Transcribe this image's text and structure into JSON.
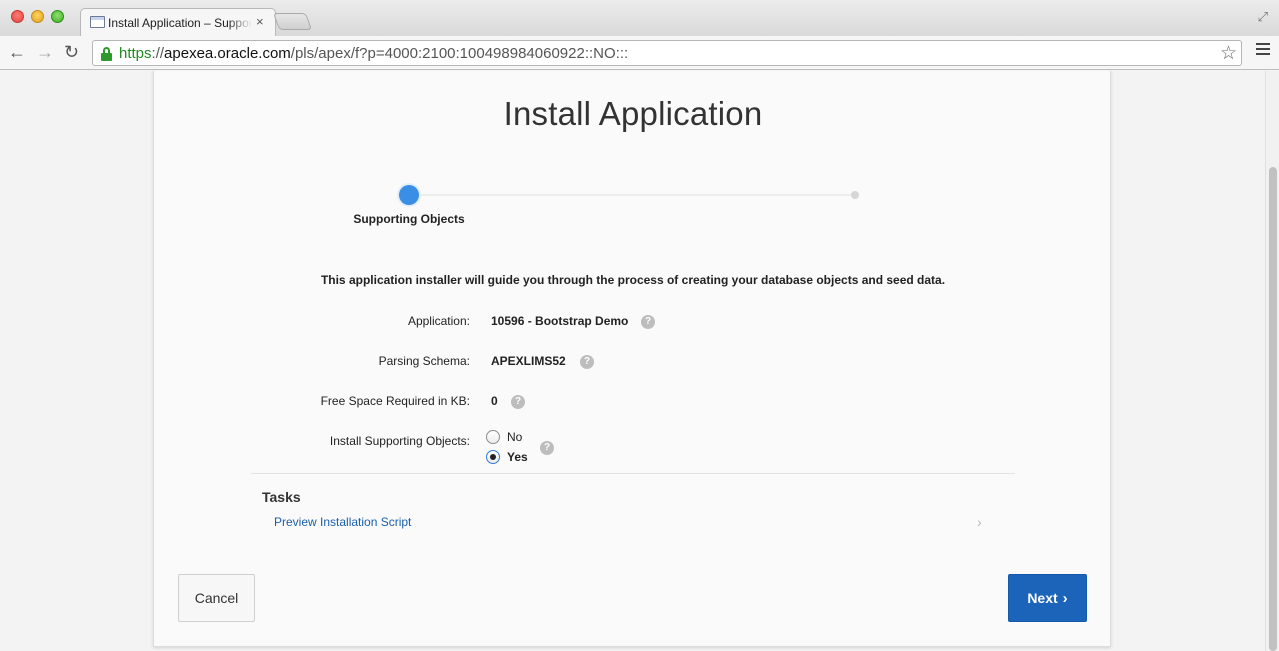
{
  "browser": {
    "tab_title": "Install Application – Supporting Objects",
    "tab_close": "×",
    "url_scheme": "https",
    "url_sep": "://",
    "url_host": "apexea.oracle.com",
    "url_path": "/pls/apex/f?p=4000:2100:100498984060922::NO:::",
    "back_glyph": "←",
    "forward_glyph": "→",
    "reload_glyph": "↻",
    "star_glyph": "☆",
    "resize_glyph": "⤢"
  },
  "page": {
    "title": "Install Application",
    "wizard": {
      "current_step_label": "Supporting Objects",
      "step_color": "#3b8ee6"
    },
    "intro": "This application installer will guide you through the process of creating your database objects and seed data.",
    "fields": {
      "application": {
        "label": "Application:",
        "value": "10596 - Bootstrap Demo"
      },
      "parsing_schema": {
        "label": "Parsing Schema:",
        "value": "APEXLIMS52"
      },
      "free_space": {
        "label": "Free Space Required in KB:",
        "value": "0"
      },
      "install_supporting": {
        "label": "Install Supporting Objects:",
        "options": [
          "No",
          "Yes"
        ],
        "selected": "Yes"
      }
    },
    "help_glyph": "?",
    "tasks": {
      "heading": "Tasks",
      "items": [
        {
          "label": "Preview Installation Script",
          "chevron": "›"
        }
      ]
    },
    "buttons": {
      "cancel": "Cancel",
      "next": "Next",
      "next_chevron": "›",
      "next_color": "#1c64b9"
    }
  }
}
